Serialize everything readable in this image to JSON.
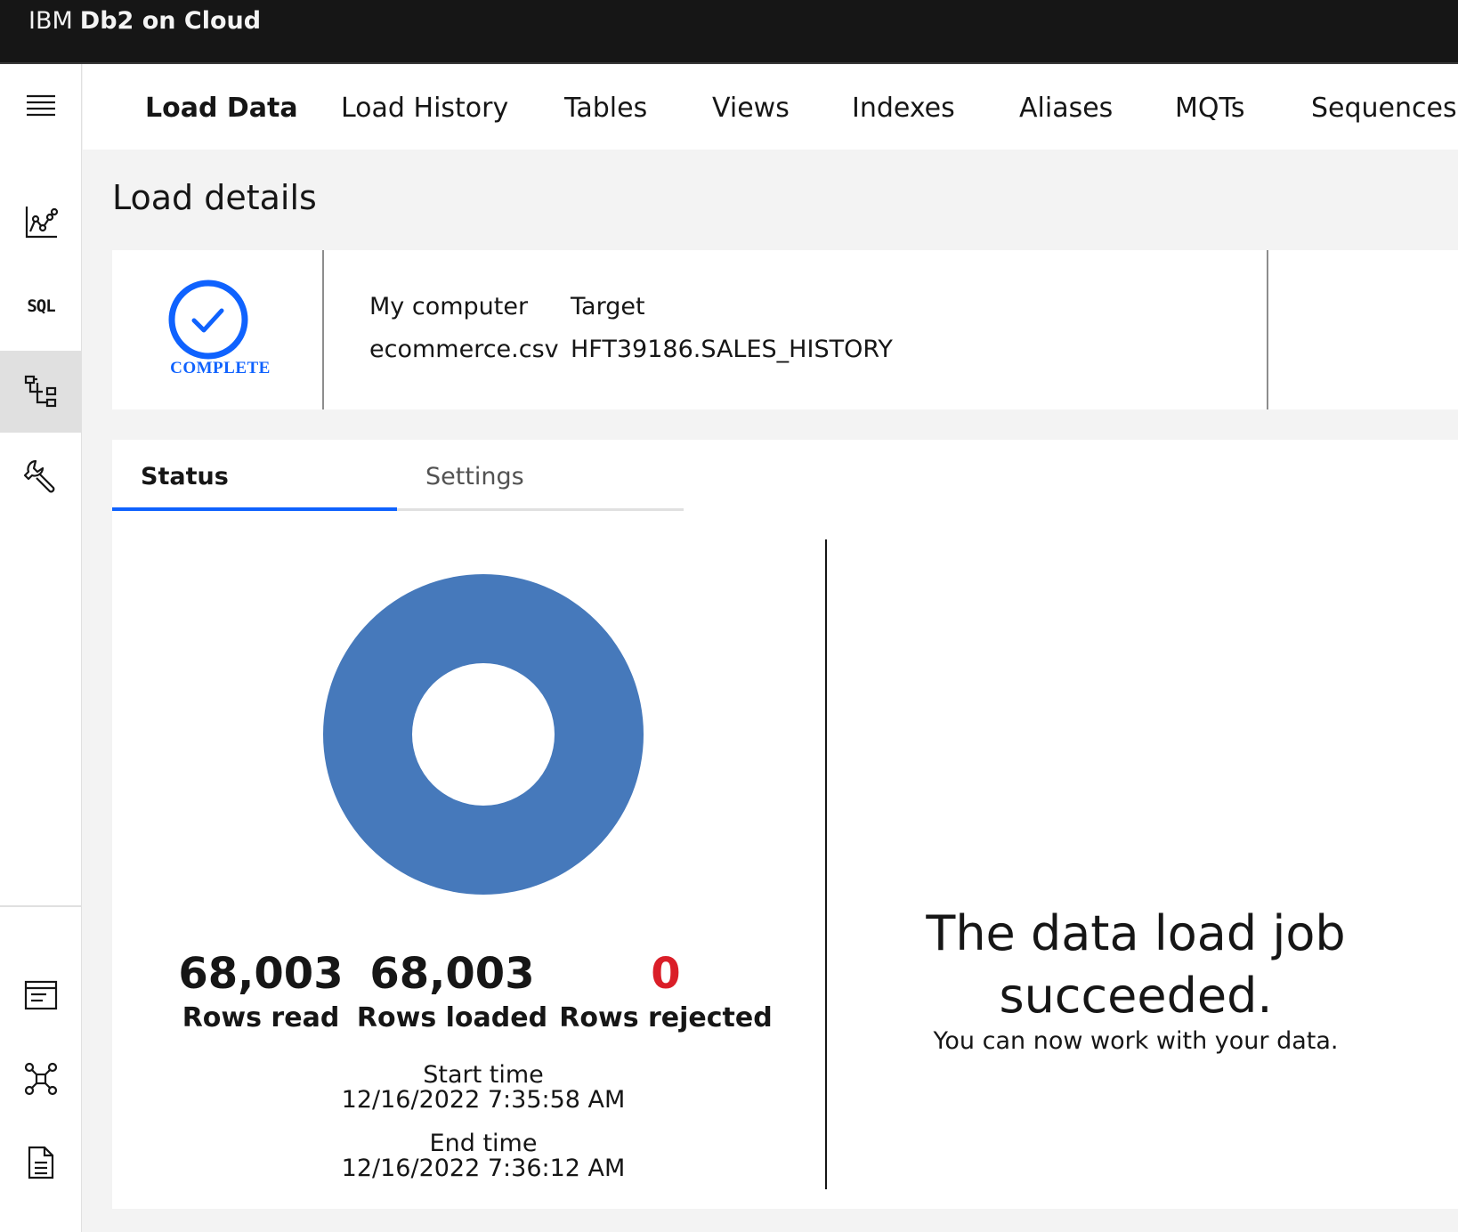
{
  "app": {
    "brand_prefix": "IBM",
    "brand_name": "Db2 on Cloud"
  },
  "sidenav": {
    "items": [
      {
        "icon": "menu-icon"
      },
      {
        "icon": "monitor-chart-icon"
      },
      {
        "icon": "sql-icon",
        "label": "SQL"
      },
      {
        "icon": "data-tree-icon",
        "active": true
      },
      {
        "icon": "wrench-icon"
      },
      {
        "icon": "log-window-icon"
      },
      {
        "icon": "network-graph-icon"
      },
      {
        "icon": "document-icon"
      },
      {
        "icon": "circle-icon"
      }
    ]
  },
  "tabs": [
    "Load Data",
    "Load History",
    "Tables",
    "Views",
    "Indexes",
    "Aliases",
    "MQTs",
    "Sequences"
  ],
  "active_tab": "Load Data",
  "page_title": "Load details",
  "summary": {
    "status": "COMPLETE",
    "status_color": "#0f62fe",
    "source_label": "My computer",
    "source_value": "ecommerce.csv",
    "target_label": "Target",
    "target_value": "HFT39186.SALES_HISTORY"
  },
  "panel_tabs": {
    "status": "Status",
    "settings": "Settings",
    "active": "Status"
  },
  "stats": {
    "rows_read": {
      "value": "68,003",
      "label": "Rows read"
    },
    "rows_loaded": {
      "value": "68,003",
      "label": "Rows loaded"
    },
    "rows_rejected": {
      "value": "0",
      "label": "Rows rejected",
      "color": "#da1e28"
    }
  },
  "times": {
    "start_label": "Start time",
    "start_value": "12/16/2022 7:35:58 AM",
    "end_label": "End time",
    "end_value": "12/16/2022 7:36:12 AM"
  },
  "message": {
    "title": "The data load job succeeded.",
    "subtitle": "You can now work with your data."
  },
  "chart_data": {
    "type": "pie",
    "categories": [
      "Rows loaded",
      "Rows rejected"
    ],
    "values": [
      68003,
      0
    ],
    "colors": [
      "#4679bb",
      "#da1e28"
    ],
    "donut": true
  }
}
